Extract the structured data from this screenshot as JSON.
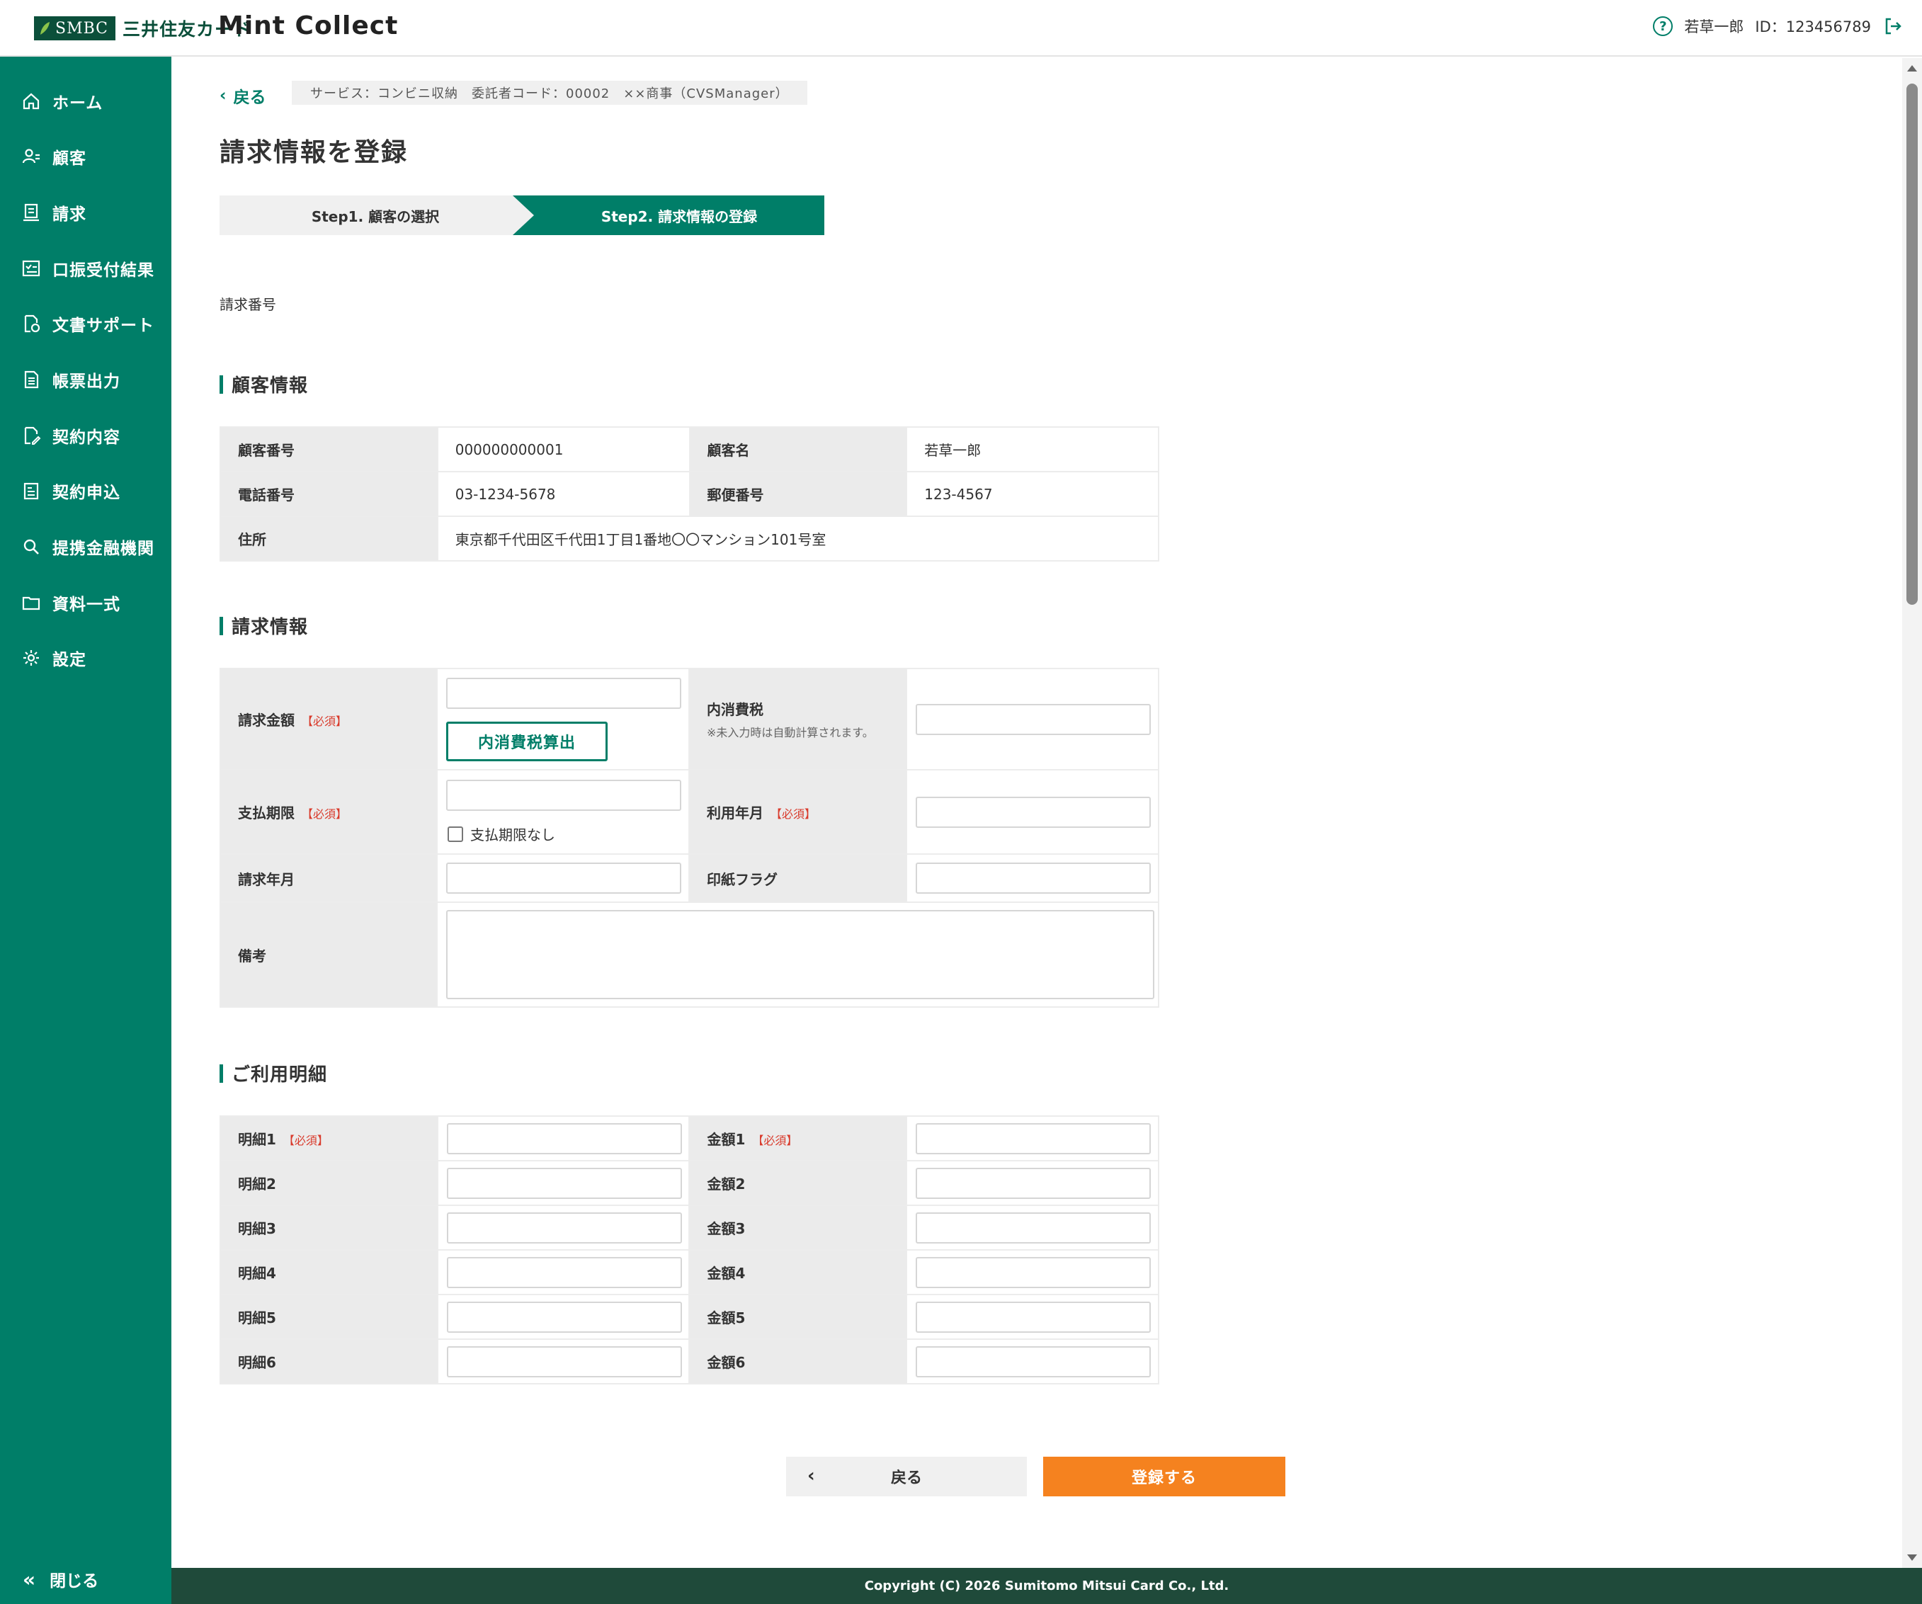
{
  "header": {
    "logo_text": "SMBC",
    "brand_jp": "三井住友カード",
    "app_title": "Mint Collect",
    "user_name": "若草一郎",
    "user_id": "ID：123456789"
  },
  "sidebar": {
    "items": [
      {
        "label": "ホーム",
        "icon": "home-icon"
      },
      {
        "label": "顧客",
        "icon": "users-icon"
      },
      {
        "label": "請求",
        "icon": "invoice-icon"
      },
      {
        "label": "口振受付結果",
        "icon": "checklist-icon"
      },
      {
        "label": "文書サポート",
        "icon": "document-support-icon"
      },
      {
        "label": "帳票出力",
        "icon": "report-icon"
      },
      {
        "label": "契約内容",
        "icon": "contract-edit-icon"
      },
      {
        "label": "契約申込",
        "icon": "application-icon"
      },
      {
        "label": "提携金融機関",
        "icon": "search-icon"
      },
      {
        "label": "資料一式",
        "icon": "folder-icon"
      },
      {
        "label": "設定",
        "icon": "gear-icon"
      }
    ],
    "close_label": "閉じる"
  },
  "breadcrumb": {
    "back_label": "戻る",
    "service_text": "サービス：コンビニ収納　委託者コード：00002　××商事（CVSManager）"
  },
  "page_title": "請求情報を登録",
  "steps": [
    {
      "label": "Step1. 顧客の選択",
      "active": false
    },
    {
      "label": "Step2. 請求情報の登録",
      "active": true
    }
  ],
  "request_no_label": "請求番号",
  "customer_section": {
    "title": "顧客情報",
    "customer_no_label": "顧客番号",
    "customer_no": "000000000001",
    "customer_name_label": "顧客名",
    "customer_name": "若草一郎",
    "phone_label": "電話番号",
    "phone": "03-1234-5678",
    "zip_label": "郵便番号",
    "zip": "123-4567",
    "address_label": "住所",
    "address": "東京都千代田区千代田1丁目1番地〇〇マンション101号室"
  },
  "billing_section": {
    "title": "請求情報",
    "required_mark": "【必須】",
    "amount_label": "請求金額",
    "calc_button": "内消費税算出",
    "tax_label": "内消費税",
    "tax_note": "※未入力時は自動計算されます。",
    "due_label": "支払期限",
    "no_due_label": "支払期限なし",
    "usage_month_label": "利用年月",
    "billing_month_label": "請求年月",
    "stamp_flag_label": "印紙フラグ",
    "remarks_label": "備考"
  },
  "details_section": {
    "title": "ご利用明細",
    "required_mark": "【必須】",
    "rows": [
      {
        "item_label": "明細1",
        "amount_label": "金額1"
      },
      {
        "item_label": "明細2",
        "amount_label": "金額2"
      },
      {
        "item_label": "明細3",
        "amount_label": "金額3"
      },
      {
        "item_label": "明細4",
        "amount_label": "金額4"
      },
      {
        "item_label": "明細5",
        "amount_label": "金額5"
      },
      {
        "item_label": "明細6",
        "amount_label": "金額6"
      }
    ]
  },
  "actions": {
    "back_label": "戻る",
    "submit_label": "登録する"
  },
  "footer": {
    "copyright": "Copyright (C) 2026 Sumitomo Mitsui Card Co., Ltd."
  },
  "colors": {
    "brand_green": "#007e68",
    "dark_green": "#1f4a3a",
    "accent_orange": "#f5821f",
    "required_red": "#d93a2b"
  }
}
